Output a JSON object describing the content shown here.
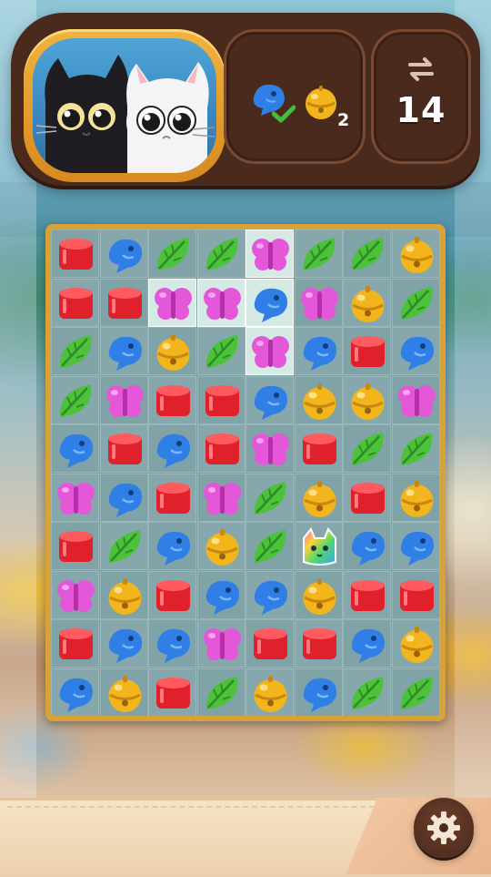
{
  "header": {
    "portrait": {
      "characters": [
        "black-cat",
        "white-cat"
      ]
    },
    "goals": [
      {
        "icon": "blue-fish-icon",
        "status": "complete",
        "status_icon": "checkmark-icon"
      },
      {
        "icon": "gold-bell-icon",
        "remaining": "2"
      }
    ],
    "moves": {
      "icon": "swap-arrows-icon",
      "value": "14"
    }
  },
  "board": {
    "columns": 8,
    "rows": 10,
    "piece_types": {
      "R": "red-block",
      "B": "blue-fish",
      "G": "green-leaf",
      "P": "pink-butterfly",
      "Y": "gold-bell",
      "C": "rainbow-cat"
    },
    "grid": [
      [
        "R",
        "B",
        "G",
        "G",
        "P",
        "G",
        "G",
        "Y"
      ],
      [
        "R",
        "R",
        "P",
        "P",
        "B",
        "P",
        "Y",
        "G"
      ],
      [
        "G",
        "B",
        "Y",
        "G",
        "P",
        "B",
        "R",
        "B"
      ],
      [
        "G",
        "P",
        "R",
        "R",
        "B",
        "Y",
        "Y",
        "P"
      ],
      [
        "B",
        "R",
        "B",
        "R",
        "P",
        "R",
        "G",
        "G"
      ],
      [
        "P",
        "B",
        "R",
        "P",
        "G",
        "Y",
        "R",
        "Y"
      ],
      [
        "R",
        "G",
        "B",
        "Y",
        "G",
        "C",
        "B",
        "B"
      ],
      [
        "P",
        "Y",
        "R",
        "B",
        "B",
        "Y",
        "R",
        "R"
      ],
      [
        "R",
        "B",
        "B",
        "P",
        "R",
        "R",
        "B",
        "Y"
      ],
      [
        "B",
        "Y",
        "R",
        "G",
        "Y",
        "B",
        "G",
        "G"
      ]
    ],
    "highlighted_cells": [
      [
        0,
        4
      ],
      [
        1,
        2
      ],
      [
        1,
        3
      ],
      [
        1,
        4
      ],
      [
        2,
        4
      ]
    ],
    "colors": {
      "red": "#e0212b",
      "blue": "#2f7fe6",
      "green": "#4cc23a",
      "pink": "#e457d9",
      "gold": "#f2b61c"
    }
  },
  "footer": {
    "settings_icon": "gear-icon"
  }
}
